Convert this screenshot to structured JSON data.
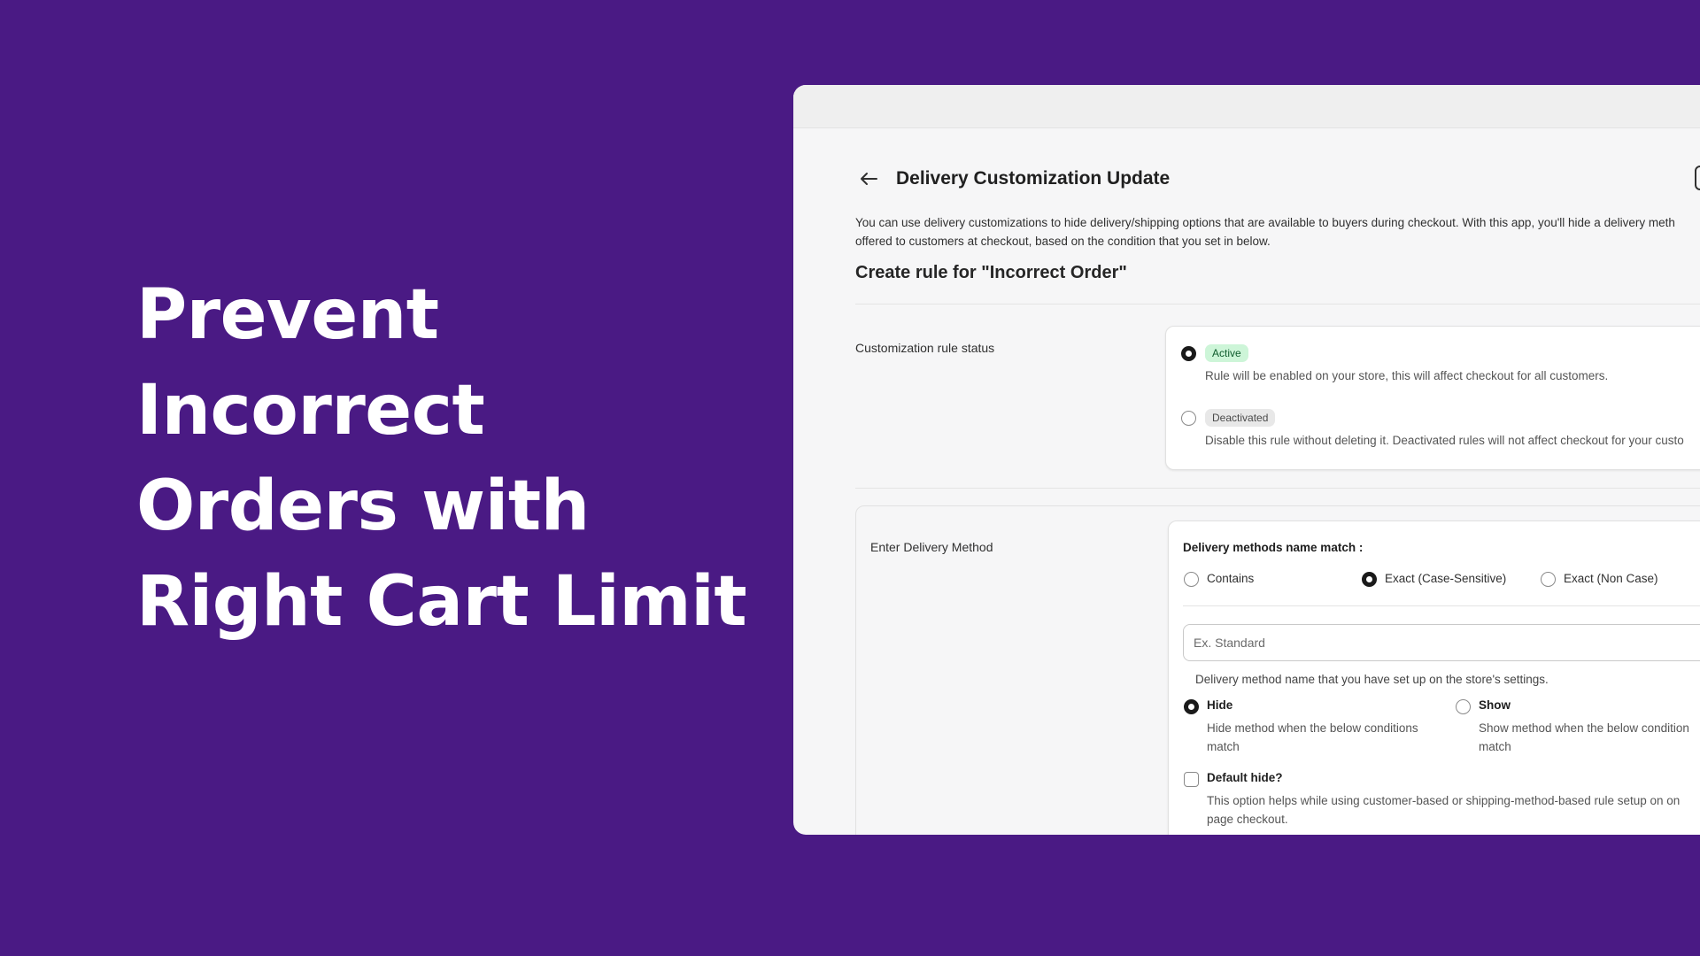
{
  "headline": {
    "line1": "Prevent",
    "line2": "Incorrect",
    "line3": "Orders with",
    "line4": "Right Cart Limit"
  },
  "header": {
    "back_icon": "arrow-left-icon",
    "title": "Delivery Customization Update"
  },
  "intro": {
    "line1": "You can use delivery customizations to hide delivery/shipping options that are available to buyers during checkout. With this app, you'll hide a delivery meth",
    "line2": "offered to customers at checkout, based on the condition that you set in below."
  },
  "rule_title": "Create rule for \"Incorrect Order\"",
  "status_section": {
    "label": "Customization rule status",
    "options": [
      {
        "badge": "Active",
        "description": "Rule will be enabled on your store, this will affect checkout for all customers.",
        "selected": true
      },
      {
        "badge": "Deactivated",
        "description": "Disable this rule without deleting it. Deactivated rules will not affect checkout for your custo",
        "selected": false
      }
    ]
  },
  "method_section": {
    "label": "Enter Delivery Method",
    "match_label": "Delivery methods name match :",
    "match_options": [
      {
        "label": "Contains",
        "selected": false
      },
      {
        "label": "Exact (Case-Sensitive)",
        "selected": true
      },
      {
        "label": "Exact (Non Case)",
        "selected": false
      }
    ],
    "name_input": {
      "placeholder": "Ex. Standard",
      "value": ""
    },
    "name_help": "Delivery method name that you have set up on the store's settings.",
    "visibility_options": [
      {
        "label": "Hide",
        "description_line1": "Hide method when the below conditions",
        "description_line2": "match",
        "selected": true
      },
      {
        "label": "Show",
        "description_line1": "Show method when the below condition",
        "description_line2": "match",
        "selected": false
      }
    ],
    "default_hide": {
      "label": "Default hide?",
      "checked": false,
      "description_line1": "This option helps while using customer-based or shipping-method-based rule setup on on",
      "description_line2": "page checkout."
    }
  },
  "colors": {
    "background": "#4a1a84",
    "headline": "#ffffff",
    "active_badge": "#cdf5d8",
    "deactivated_badge": "#e8e8e8"
  }
}
